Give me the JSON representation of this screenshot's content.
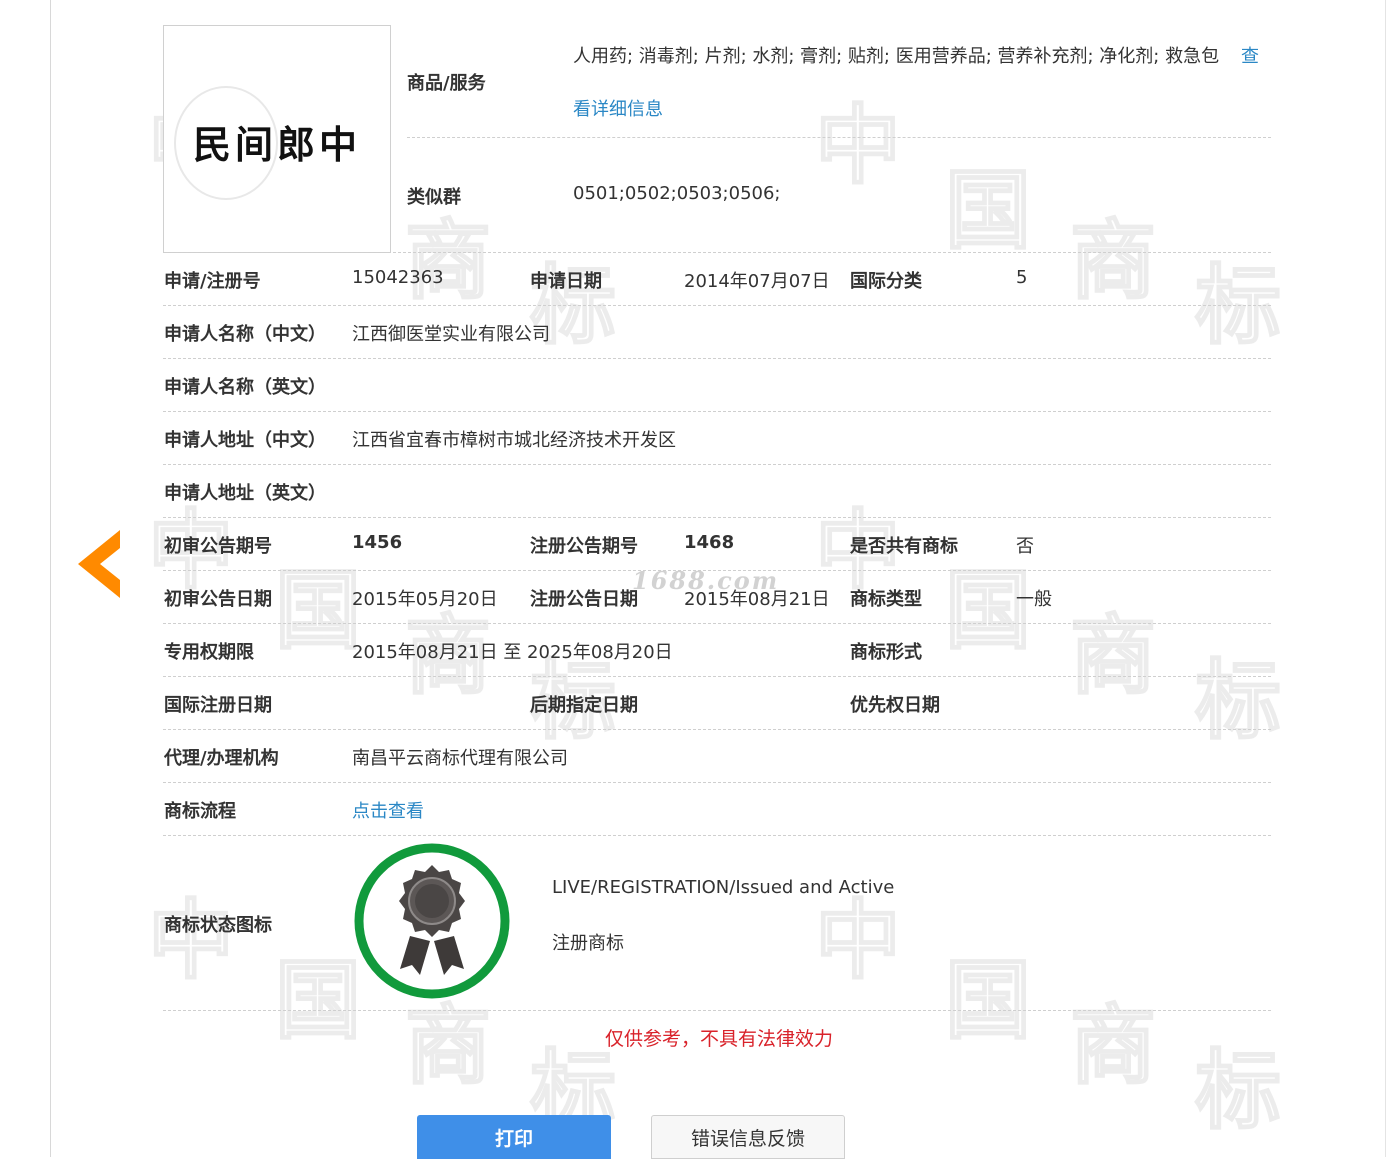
{
  "colors": {
    "link": "#2a87c5",
    "accent_orange": "#ff8a00",
    "badge_green": "#119a3c",
    "print_button": "#3f8fe8",
    "disclaimer_red": "#d9222a"
  },
  "logo": {
    "text": "民间郎中"
  },
  "goods": {
    "label": "商品/服务",
    "value": "人用药; 消毒剂; 片剂; 水剂; 膏剂; 贴剂; 医用营养品; 营养补充剂; 净化剂; 救急包",
    "more_link_part1": "查",
    "more_link_part2": "看详细信息"
  },
  "similar": {
    "label": "类似群",
    "value": "0501;0502;0503;0506;"
  },
  "row_reg": {
    "label1": "申请/注册号",
    "value1": "15042363",
    "label2": "申请日期",
    "value2": "2014年07月07日",
    "label3": "国际分类",
    "value3": "5"
  },
  "row_applicant_cn": {
    "label": "申请人名称（中文）",
    "value": "江西御医堂实业有限公司"
  },
  "row_applicant_en": {
    "label": "申请人名称（英文）",
    "value": ""
  },
  "row_address_cn": {
    "label": "申请人地址（中文）",
    "value": "江西省宜春市樟树市城北经济技术开发区"
  },
  "row_address_en": {
    "label": "申请人地址（英文）",
    "value": ""
  },
  "row_pub_no": {
    "label1": "初审公告期号",
    "value1": "1456",
    "label2": "注册公告期号",
    "value2": "1468",
    "label3": "是否共有商标",
    "value3": "否"
  },
  "row_pub_date": {
    "label1": "初审公告日期",
    "value1": "2015年05月20日",
    "label2": "注册公告日期",
    "value2": "2015年08月21日",
    "label3": "商标类型",
    "value3": "一般"
  },
  "row_term": {
    "label1": "专用权期限",
    "value1": "2015年08月21日 至 2025年08月20日",
    "label3": "商标形式",
    "value3": ""
  },
  "row_intl": {
    "label1": "国际注册日期",
    "label2": "后期指定日期",
    "label3": "优先权日期"
  },
  "row_agent": {
    "label": "代理/办理机构",
    "value": "南昌平云商标代理有限公司"
  },
  "row_flow": {
    "label": "商标流程",
    "link": "点击查看"
  },
  "row_status": {
    "label": "商标状态图标",
    "status_en": "LIVE/REGISTRATION/Issued and Active",
    "status_cn": "注册商标"
  },
  "disclaimer": "仅供参考，不具有法律效力",
  "buttons": {
    "print": "打印",
    "feedback": "错误信息反馈"
  },
  "watermark": {
    "site": "1688.com",
    "chars": [
      "中",
      "国",
      "商",
      "标"
    ]
  },
  "icons": {
    "back": "chevron-left-icon",
    "badge": "ribbon-award-icon"
  }
}
